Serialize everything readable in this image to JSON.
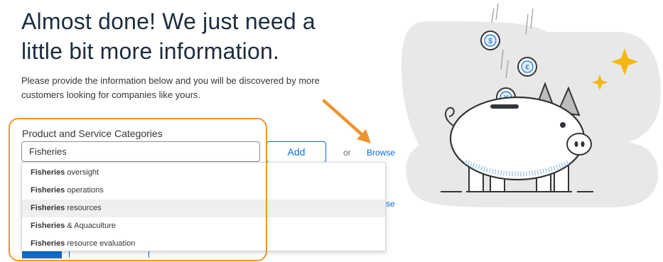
{
  "heading": "Almost done! We just need a little bit more information.",
  "description": "Please provide the information below and you will be discovered by more customers looking for companies like yours.",
  "category_field": {
    "label": "Product and Service Categories",
    "value": "Fisheries"
  },
  "add_label": "Add",
  "or_label": "or",
  "browse_label": "Browse",
  "partial_link_text": "se",
  "suggestions": [
    {
      "match": "Fisheries",
      "rest": " oversight"
    },
    {
      "match": "Fisheries",
      "rest": " operations"
    },
    {
      "match": "Fisheries",
      "rest": " resources"
    },
    {
      "match": "Fisheries",
      "rest": " & Aquaculture"
    },
    {
      "match": "Fisheries",
      "rest": " resource evaluation"
    }
  ],
  "active_suggestion_index": 2,
  "colors": {
    "accent_blue": "#0a6ed1",
    "annotation_orange": "#f0932e",
    "sparkle_yellow": "#f5b70f",
    "illustration_gray": "#e8e8e8"
  },
  "icons": {
    "coin_1": "dollar-coin-icon",
    "coin_2": "euro-coin-icon",
    "coin_3": "yen-coin-icon",
    "sparkles": "sparkle-icon"
  }
}
